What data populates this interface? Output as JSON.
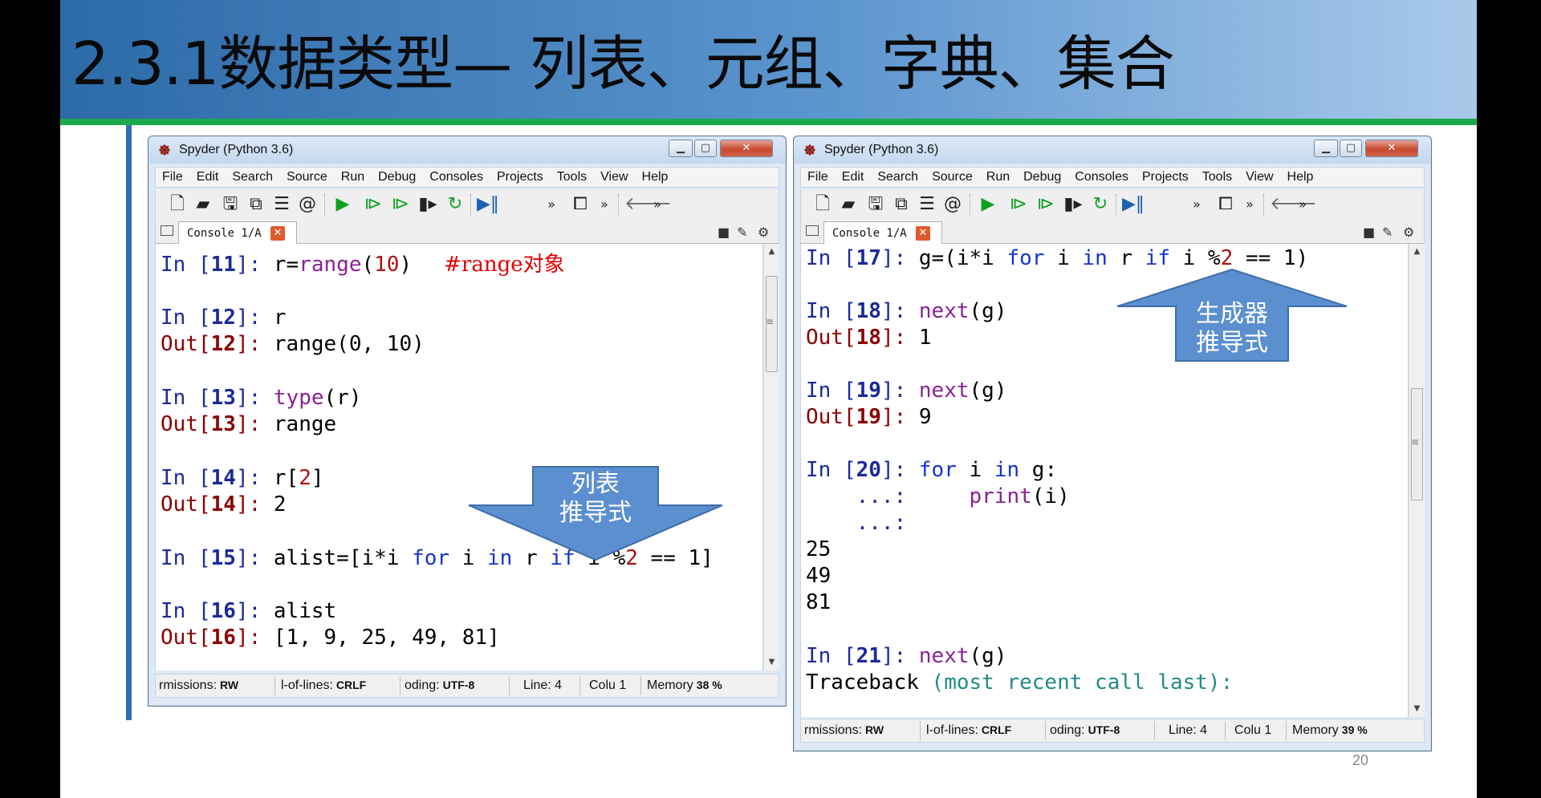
{
  "slide": {
    "title": "2.3.1数据类型— 列表、元组、字典、集合",
    "page_number": "20"
  },
  "left_window": {
    "title": "Spyder (Python 3.6)",
    "menu": [
      "File",
      "Edit",
      "Search",
      "Source",
      "Run",
      "Debug",
      "Consoles",
      "Projects",
      "Tools",
      "View",
      "Help"
    ],
    "tab_label": "Console 1/A",
    "console": {
      "l1_prompt": "In [",
      "l1_num": "11",
      "l1_end": "]: ",
      "l1_a": "r=",
      "l1_b": "range",
      "l1_c": "(",
      "l1_d": "10",
      "l1_e": ")",
      "l1_comment": "#range对象",
      "l2_prompt": "In [",
      "l2_num": "12",
      "l2_end": "]: ",
      "l2_code": "r",
      "l3_prompt": "Out[",
      "l3_num": "12",
      "l3_end": "]: ",
      "l3_code": "range(0, 10)",
      "l4_prompt": "In [",
      "l4_num": "13",
      "l4_end": "]: ",
      "l4_a": "type",
      "l4_b": "(r)",
      "l5_prompt": "Out[",
      "l5_num": "13",
      "l5_end": "]: ",
      "l5_code": "range",
      "l6_prompt": "In [",
      "l6_num": "14",
      "l6_end": "]: ",
      "l6_a": "r[",
      "l6_b": "2",
      "l6_c": "]",
      "l7_prompt": "Out[",
      "l7_num": "14",
      "l7_end": "]: ",
      "l7_code": "2",
      "l8_prompt": "In [",
      "l8_num": "15",
      "l8_end": "]: ",
      "l8_a": "alist=[i*i ",
      "l8_b": "for",
      "l8_c": " i ",
      "l8_d": "in",
      "l8_e": " r ",
      "l8_f": "if",
      "l8_g": " i %",
      "l8_h": "2",
      "l8_i": " == 1]",
      "l9_prompt": "In [",
      "l9_num": "16",
      "l9_end": "]: ",
      "l9_code": "alist",
      "l10_prompt": "Out[",
      "l10_num": "16",
      "l10_end": "]: ",
      "l10_code": "[1, 9, 25, 49, 81]"
    },
    "status": {
      "permissions_label": "rmissions:",
      "permissions_value": "RW",
      "eol_label": "l-of-lines:",
      "eol_value": "CRLF",
      "encoding_label": "oding:",
      "encoding_value": "UTF-8",
      "line": "Line: 4",
      "column": "Colu 1",
      "memory_label": "Memory",
      "memory_value": "38 %"
    },
    "callout": {
      "line1": "列表",
      "line2": "推导式"
    }
  },
  "right_window": {
    "title": "Spyder (Python 3.6)",
    "menu": [
      "File",
      "Edit",
      "Search",
      "Source",
      "Run",
      "Debug",
      "Consoles",
      "Projects",
      "Tools",
      "View",
      "Help"
    ],
    "tab_label": "Console 1/A",
    "console": {
      "l1_prompt": "In [",
      "l1_num": "17",
      "l1_end": "]: ",
      "l1_a": "g=(i*i ",
      "l1_b": "for",
      "l1_c": " i ",
      "l1_d": "in",
      "l1_e": " r ",
      "l1_f": "if",
      "l1_g": " i %",
      "l1_h": "2",
      "l1_i": " == 1)",
      "l2_prompt": "In [",
      "l2_num": "18",
      "l2_end": "]: ",
      "l2_a": "next",
      "l2_b": "(g)",
      "l3_prompt": "Out[",
      "l3_num": "18",
      "l3_end": "]: ",
      "l3_code": "1",
      "l4_prompt": "In [",
      "l4_num": "19",
      "l4_end": "]: ",
      "l4_a": "next",
      "l4_b": "(g)",
      "l5_prompt": "Out[",
      "l5_num": "19",
      "l5_end": "]: ",
      "l5_code": "9",
      "l6_prompt": "In [",
      "l6_num": "20",
      "l6_end": "]: ",
      "l6_a": "for",
      "l6_b": " i ",
      "l6_c": "in",
      "l6_d": " g:",
      "l7_cont": "    ...:     ",
      "l7_a": "print",
      "l7_b": "(i)",
      "l8_cont": "    ...:",
      "l9_code": "25",
      "l10_code": "49",
      "l11_code": "81",
      "l12_prompt": "In [",
      "l12_num": "21",
      "l12_end": "]: ",
      "l12_a": "next",
      "l12_b": "(g)",
      "l13_a": "Traceback ",
      "l13_b": "(most recent call last):"
    },
    "status": {
      "permissions_label": "rmissions:",
      "permissions_value": "RW",
      "eol_label": "l-of-lines:",
      "eol_value": "CRLF",
      "encoding_label": "oding:",
      "encoding_value": "UTF-8",
      "line": "Line: 4",
      "column": "Colu 1",
      "memory_label": "Memory",
      "memory_value": "39 %"
    },
    "callout": {
      "line1": "生成器",
      "line2": "推导式"
    }
  },
  "colors": {
    "prompt_in": "#1a2a9a",
    "prompt_out": "#8b0000",
    "keyword": "#1434d0",
    "builtin": "#8b2296",
    "number": "#b01010",
    "comment": "#e00000",
    "callout_fill": "#5b8fcf"
  }
}
